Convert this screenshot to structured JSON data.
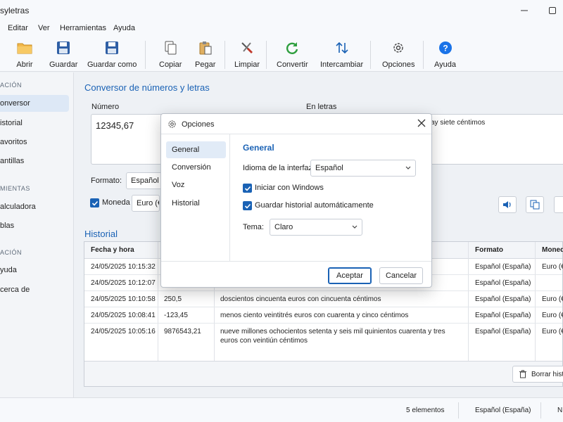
{
  "window": {
    "title": "syletras"
  },
  "menu": [
    "Editar",
    "Ver",
    "Herramientas",
    "Ayuda"
  ],
  "toolbar": [
    "Abrir",
    "Guardar",
    "Guardar como",
    "Copiar",
    "Pegar",
    "Limpiar",
    "Convertir",
    "Intercambiar",
    "Opciones",
    "Ayuda"
  ],
  "sidebar": {
    "sections": [
      "ACIÓN",
      "MIENTAS",
      "ACIÓN"
    ],
    "items": [
      "onversor",
      "istorial",
      "avoritos",
      "antillas",
      "alculadora",
      "blas",
      "yuda",
      "cerca de"
    ]
  },
  "converter": {
    "title": "Conversor de números y letras",
    "number_label": "Número",
    "number_value": "12345,67",
    "letters_label": "En letras",
    "letters_value": "ay siete céntimos",
    "format_label": "Formato:",
    "format_value": "Español (Es",
    "currency_label": "Moneda",
    "currency_value": "Euro (€)"
  },
  "history": {
    "title": "Historial",
    "columns": [
      "Fecha y hora",
      "",
      "",
      "Formato",
      "Moned"
    ],
    "rows": [
      {
        "date": "24/05/2025 10:15:32",
        "number": "",
        "text": "",
        "format": "Español (España)",
        "currency": "Euro (€)"
      },
      {
        "date": "24/05/2025 10:12:07",
        "number": "",
        "text": "",
        "format": "Español (España)",
        "currency": ""
      },
      {
        "date": "24/05/2025 10:10:58",
        "number": "250,5",
        "text": "doscientos cincuenta euros con cincuenta céntimos",
        "format": "Español (España)",
        "currency": "Euro (€)"
      },
      {
        "date": "24/05/2025 10:08:41",
        "number": "-123,45",
        "text": "menos ciento veintitrés euros con cuarenta y cinco céntimos",
        "format": "Español (España)",
        "currency": "Euro (€)"
      },
      {
        "date": "24/05/2025 10:05:16",
        "number": "9876543,21",
        "text": "nueve millones ochocientos setenta y seis mil quinientos cuarenta y tres euros con veintiún céntimos",
        "format": "Español (España)",
        "currency": "Euro (€)"
      }
    ],
    "clear_label": "Borrar histo"
  },
  "status": {
    "count": "5 elementos",
    "locale": "Español (España)",
    "extra": "N"
  },
  "dialog": {
    "title": "Opciones",
    "nav": [
      "General",
      "Conversión",
      "Voz",
      "Historial"
    ],
    "section": "General",
    "language_label": "Idioma de la interfaz:",
    "language_value": "Español",
    "start_windows": "Iniciar con Windows",
    "save_history": "Guardar historial automáticamente",
    "theme_label": "Tema:",
    "theme_value": "Claro",
    "accept": "Aceptar",
    "cancel": "Cancelar"
  },
  "colors": {
    "accent": "#1a62b5",
    "convert_green": "#2e9e3e",
    "help_blue": "#1a73e8"
  }
}
